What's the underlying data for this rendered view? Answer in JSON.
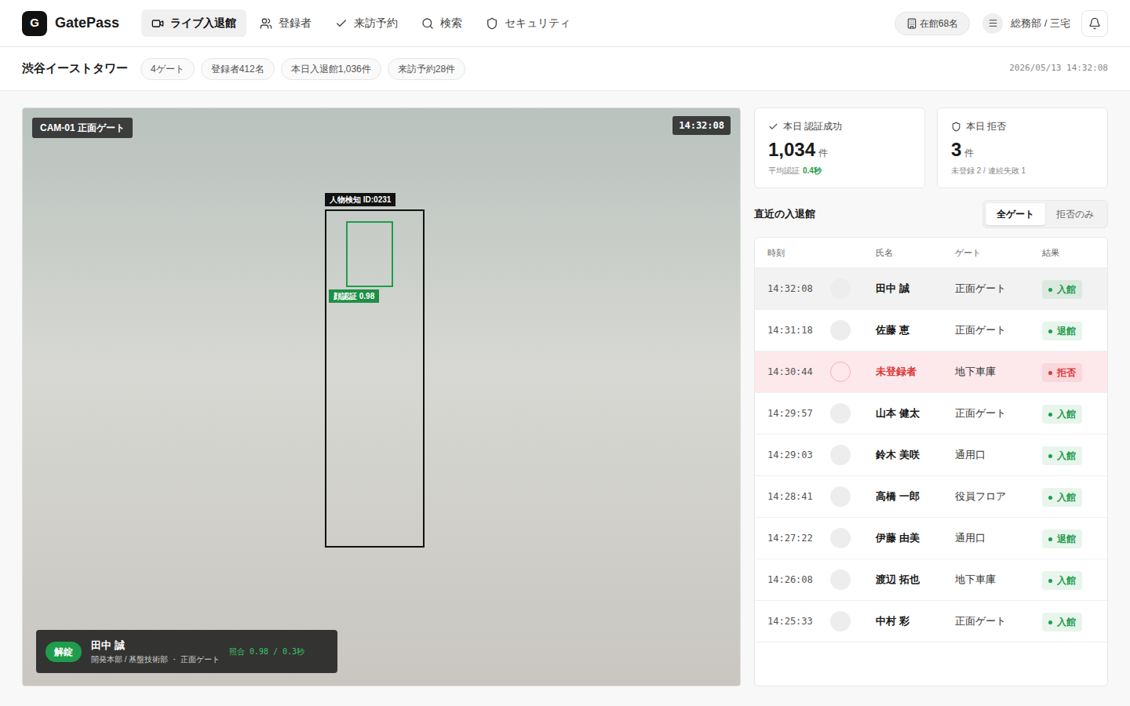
{
  "app": {
    "logo": "G",
    "name": "GatePass"
  },
  "nav": [
    {
      "label": "ライブ入退館",
      "selected": true,
      "kind": "live"
    },
    {
      "label": "登録者",
      "selected": false,
      "kind": "users"
    },
    {
      "label": "来訪予約",
      "selected": false,
      "kind": "visit"
    },
    {
      "label": "検索",
      "selected": false,
      "kind": "search"
    },
    {
      "label": "セキュリティ",
      "selected": false,
      "kind": "security"
    }
  ],
  "header_right": {
    "occupancy": "在館68名",
    "user": "総務部 / 三宅"
  },
  "site": {
    "name": "渋谷イーストタワー",
    "chips": [
      "4ゲート",
      "登録者412名",
      "本日入退館1,036件",
      "来訪予約28件"
    ],
    "datetime": "2026/05/13 14:32:08"
  },
  "camera": {
    "label": "CAM-01 正面ゲート",
    "time": "14:32:08",
    "person_tag": "人物検知 ID:0231",
    "face_tag": "顔認証 0.98",
    "result": {
      "badge": "解錠",
      "name": "田中 誠",
      "detail": "開発本部 / 基盤技術部 ・ 正面ゲート",
      "score": "照合 0.98 / 0.3秒"
    }
  },
  "stats": [
    {
      "kind": "success",
      "title": "本日 認証成功",
      "value": "1,034",
      "unit": "件",
      "note": "平均認証",
      "note_value": "0.4秒"
    },
    {
      "kind": "denied",
      "title": "本日 拒否",
      "value": "3",
      "unit": "件",
      "note": "未登録 2 / 連続失敗 1"
    }
  ],
  "log": {
    "title": "直近の入退館",
    "filters": [
      {
        "label": "全ゲート",
        "selected": true
      },
      {
        "label": "拒否のみ",
        "selected": false
      }
    ],
    "columns": [
      "時刻",
      "氏名",
      "ゲート",
      "結果"
    ],
    "rows": [
      {
        "time": "14:32:08",
        "name": "田中 誠",
        "gate": "正面ゲート",
        "result": "入館",
        "denied": false,
        "selected": true,
        "color": "#1f9d4c"
      },
      {
        "time": "14:31:18",
        "name": "佐藤 恵",
        "gate": "正面ゲート",
        "result": "退館",
        "denied": false,
        "selected": false,
        "color": "#1f9d4c"
      },
      {
        "time": "14:30:44",
        "name": "未登録者",
        "gate": "地下車庫",
        "result": "拒否",
        "denied": true,
        "selected": false,
        "color": "#d93a3a"
      },
      {
        "time": "14:29:57",
        "name": "山本 健太",
        "gate": "正面ゲート",
        "result": "入館",
        "denied": false,
        "selected": false,
        "color": "#1f9d4c"
      },
      {
        "time": "14:29:03",
        "name": "鈴木 美咲",
        "gate": "通用口",
        "result": "入館",
        "denied": false,
        "selected": false,
        "color": "#1f9d4c"
      },
      {
        "time": "14:28:41",
        "name": "高橋 一郎",
        "gate": "役員フロア",
        "result": "入館",
        "denied": false,
        "selected": false,
        "color": "#1f9d4c"
      },
      {
        "time": "14:27:22",
        "name": "伊藤 由美",
        "gate": "通用口",
        "result": "退館",
        "denied": false,
        "selected": false,
        "color": "#1f9d4c"
      },
      {
        "time": "14:26:08",
        "name": "渡辺 拓也",
        "gate": "地下車庫",
        "result": "入館",
        "denied": false,
        "selected": false,
        "color": "#1f9d4c"
      },
      {
        "time": "14:25:33",
        "name": "中村 彩",
        "gate": "正面ゲート",
        "result": "入館",
        "denied": false,
        "selected": false,
        "color": "#1f9d4c"
      }
    ]
  }
}
